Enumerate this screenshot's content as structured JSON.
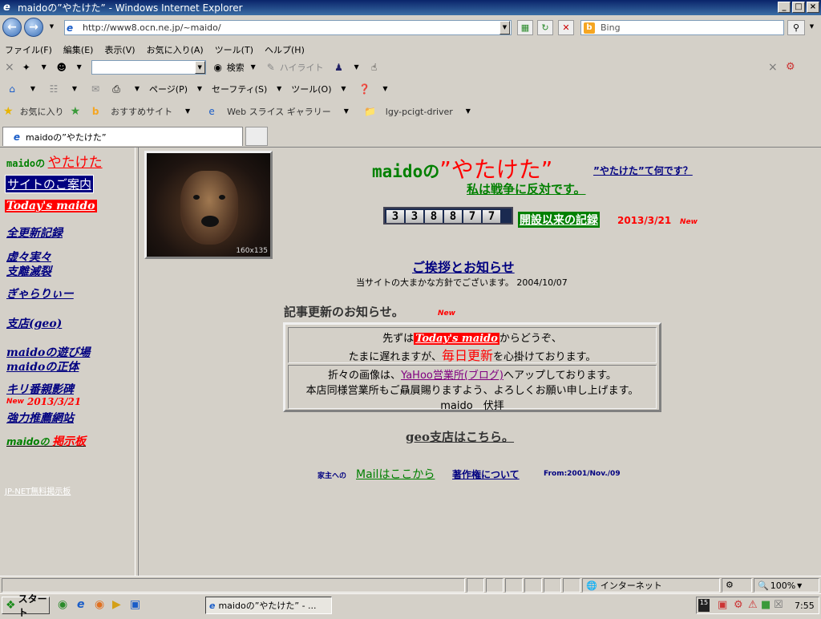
{
  "window": {
    "title": "maidoの”やたけた” - Windows Internet Explorer",
    "buttons": [
      "_",
      "□",
      "×"
    ]
  },
  "address_bar": {
    "url": "http://www8.ocn.ne.jp/~maido/",
    "search_placeholder": "Bing"
  },
  "menu": [
    "ファイル(F)",
    "編集(E)",
    "表示(V)",
    "お気に入り(A)",
    "ツール(T)",
    "ヘルプ(H)"
  ],
  "toolbar1": {
    "search_label": "検索",
    "highlight_label": "ハイライト"
  },
  "command_bar": {
    "page": "ページ(P)",
    "safety": "セーフティ(S)",
    "tools": "ツール(O)"
  },
  "favorites_bar": {
    "favorites": "お気に入り",
    "suggested": "おすすめサイト",
    "webslice": "Web スライス ギャラリー",
    "folder": "lgy-pcigt-driver"
  },
  "tab": {
    "title": "maidoの”やたけた”"
  },
  "sidebar": {
    "site_prefix": "maidoの",
    "site_name": "やたけた",
    "guide": "サイトのご案内",
    "today": "Today's maido",
    "full_update": "全更新記録",
    "kyokyo": "虚々実々",
    "shiri": "支離滅裂",
    "gallery": "ぎゃらりぃー",
    "branch": "支店(geo)",
    "playground": "maidoの遊び場",
    "identity": "maidoの正体",
    "kiriban": "キリ番親影碑",
    "new_badge": "New",
    "new_date": "2013/3/21",
    "recommend": "強力推薦網站",
    "bbs_prefix": "maidoの",
    "bbs": "掲示板",
    "jpnet": "JP-NET無料掲示板"
  },
  "main": {
    "title_prefix": "maidoの",
    "title_main": "”やたけた”",
    "what_link": "”やたけた”て何です？",
    "anti_war": "私は戦争に反対です。",
    "counter_digits": [
      "3",
      "3",
      "8",
      "8",
      "7",
      "7"
    ],
    "records_link": "開設以来の記録",
    "records_date": "2013/3/21",
    "new_badge": "New",
    "greeting_link": "ご挨拶とお知らせ",
    "greeting_sub": "当サイトの大まかな方針でございます。 2004/10/07",
    "updates_heading": "記事更新のお知らせ。",
    "updates_new": "New",
    "msg1_pre": "先ずは",
    "msg1_link": "Today's maido",
    "msg1_post": "からどうぞ、",
    "msg2_pre": "たまに遅れますが、",
    "msg2_em": "毎日更新",
    "msg2_post": "を心掛けております。",
    "msg3_pre": "折々の画像は、",
    "msg3_link": "YaHoo営業所(ブログ)",
    "msg3_post": "へアップしております。",
    "msg4": "本店同様営業所もご贔屓賜りますよう、よろしくお願い申し上げます。",
    "msg5": "maido　伏拝",
    "geo_link": "geo支店はこちら。",
    "mail_prefix": "家主への",
    "mail_link": "Mailはここから",
    "copyright_link": "著作権について",
    "from_text": "From:2001/Nov./09",
    "photo_dims": "160x135"
  },
  "statusbar": {
    "zone": "インターネット",
    "zoom": "100%"
  },
  "taskbar": {
    "start": "スタート",
    "task": "maidoの”やたけた” - ...",
    "clock": "7:55"
  },
  "colors": {
    "link": "#000080",
    "red": "#ff0000",
    "green": "#008000",
    "panel": "#d4d0c8"
  }
}
